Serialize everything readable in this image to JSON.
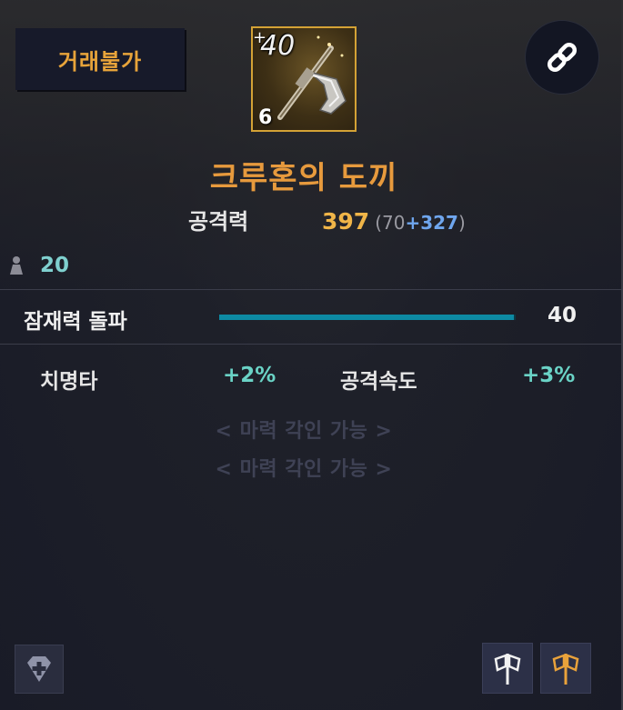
{
  "tooltip": {
    "trade_status": "거래불가",
    "item": {
      "name": "크루혼의 도끼",
      "enhancement_level": "40",
      "plus_mark": "+",
      "slot_count": "6",
      "icon": "axe-icon"
    },
    "link_icon": "link-icon",
    "attack": {
      "label": "공격력",
      "value": "397",
      "paren_open": "(",
      "base": "70",
      "bonus": "+327",
      "paren_close": ")"
    },
    "required_level": {
      "icon": "character-level-icon",
      "value": "20"
    },
    "potential_breakthrough": {
      "label": "잠재력 돌파",
      "value": "40",
      "progress_fraction": 0.995
    },
    "stats": [
      {
        "label": "치명타",
        "value": "+2%"
      },
      {
        "label": "공격속도",
        "value": "+3%"
      }
    ],
    "engraving_slots": [
      "< 마력 각인 가능 >",
      "< 마력 각인 가능 >"
    ],
    "footer": {
      "gem_button_icon": "gem-add-icon",
      "set_icons": [
        "axe-set-icon-white",
        "axe-set-icon-gold"
      ]
    },
    "colors": {
      "item_name": "#e79a3d",
      "attack_value": "#f0b548",
      "attack_bonus": "#6fa6ee",
      "stat_value": "#6ad3c6",
      "potential_bar": "#0d8aa3",
      "icon_border": "#d4a235"
    }
  }
}
